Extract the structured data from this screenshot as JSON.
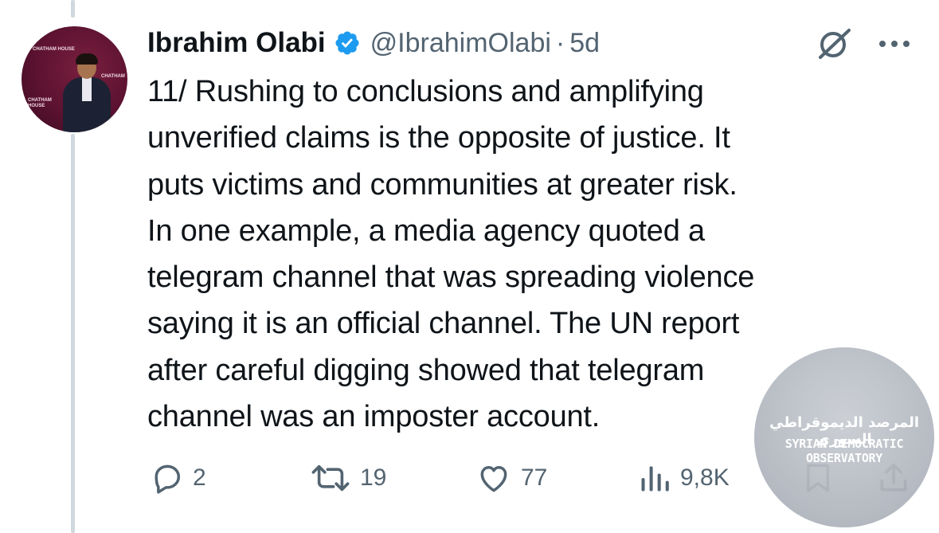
{
  "tweet": {
    "author": {
      "display_name": "Ibrahim Olabi",
      "handle": "@IbrahimOlabi",
      "separator": "·",
      "time_ago": "5d",
      "verified": true,
      "avatar_backdrop_text": [
        "CHATHAM HOUSE",
        "CHATHAM",
        "CHATHAM HOUSE"
      ]
    },
    "text_lines": [
      "11/ Rushing to conclusions and amplifying",
      "unverified claims is the opposite of justice. It",
      "puts victims and communities at greater risk.",
      "In one example, a media agency quoted a",
      "telegram channel that was spreading violence",
      "saying it is an official channel. The UN report",
      "after careful digging showed that telegram",
      "channel was an imposter account."
    ],
    "actions": {
      "replies": "2",
      "reposts": "19",
      "likes": "77",
      "views": "9,8K"
    },
    "icons": {
      "verified": "verified-badge-icon",
      "grok": "grok-icon",
      "more": "more-icon",
      "reply": "reply-icon",
      "repost": "repost-icon",
      "like": "heart-icon",
      "views": "views-icon",
      "bookmark": "bookmark-icon",
      "share": "share-icon"
    },
    "colors": {
      "verified_blue": "#1d9bf0",
      "secondary_text": "#536471",
      "primary_text": "#0f1419",
      "thread_line": "#cfd9de"
    }
  },
  "watermark": {
    "arabic": "المرصد الديموقراطي السوري",
    "english": "SYRIAN DEMOCRATIC OBSERVATORY"
  }
}
